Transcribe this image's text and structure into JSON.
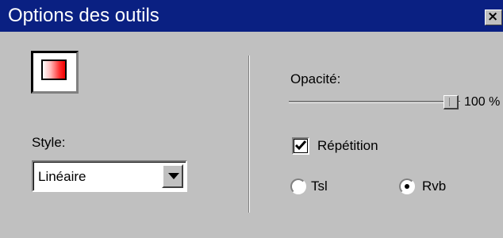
{
  "window": {
    "title": "Options des outils",
    "close_label": "×"
  },
  "tool": {
    "swatch_icon": "gradient-swatch-icon",
    "gradient_colors": [
      "#ffffff",
      "#ff0000"
    ]
  },
  "style": {
    "label": "Style:",
    "selected": "Linéaire"
  },
  "opacity": {
    "label": "Opacité:",
    "value_text": "100 %",
    "value": 100
  },
  "repeat": {
    "label": "Répétition",
    "checked": true
  },
  "color_mode": {
    "options": [
      {
        "label": "Tsl",
        "selected": false
      },
      {
        "label": "Rvb",
        "selected": true
      }
    ]
  },
  "colors": {
    "titlebar": "#0a2082",
    "face": "#c0c0c0"
  }
}
